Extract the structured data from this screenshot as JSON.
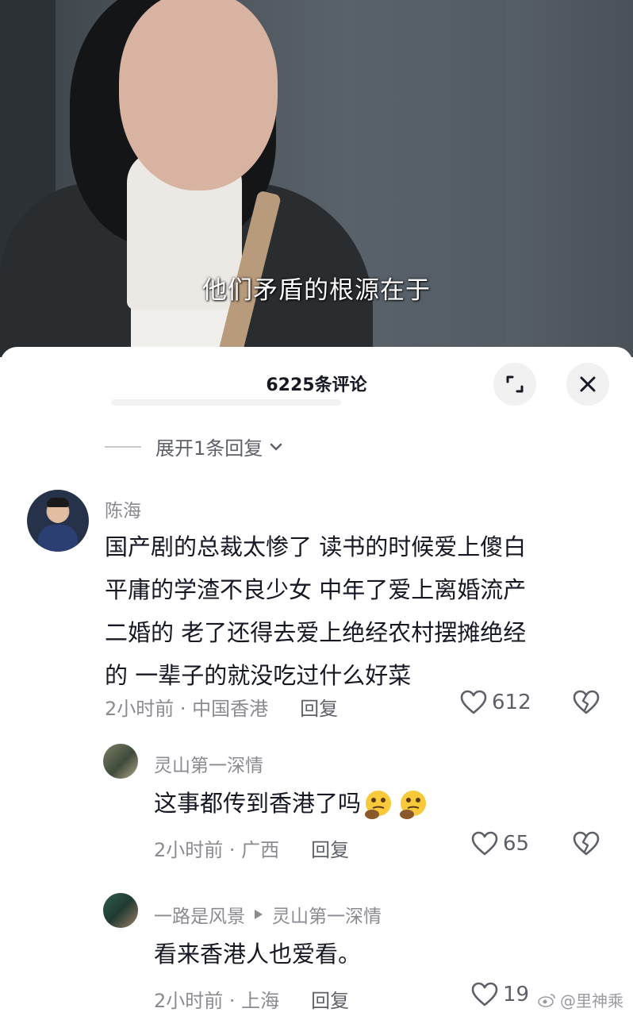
{
  "video": {
    "subtitle": "他们矛盾的根源在于"
  },
  "sheet": {
    "title": "6225条评论",
    "expand_icon": "expand-corners-icon",
    "close_icon": "close-icon",
    "expand_replies_label": "展开1条回复"
  },
  "comments": [
    {
      "username": "陈海",
      "text_lines": [
        "国产剧的总裁太惨了 读书的时候爱上傻白",
        "平庸的学渣不良少女 中年了爱上离婚流产",
        "二婚的  老了还得去爱上绝经农村摆摊绝经",
        "的   一辈子的就没吃过什么好菜"
      ],
      "time_location": "2小时前 · 中国香港",
      "reply_label": "回复",
      "likes": "612"
    },
    {
      "username": "灵山第一深情",
      "text": "这事都传到香港了吗",
      "time_location": "2小时前 · 广西",
      "reply_label": "回复",
      "likes": "65",
      "emoji": "thinking-face-icon"
    },
    {
      "username": "一路是风景",
      "reply_to": "灵山第一深情",
      "text": "看来香港人也爱看。",
      "time_location": "2小时前 · 上海",
      "reply_label": "回复",
      "likes": "19"
    }
  ],
  "watermark": "@里神乘",
  "colors": {
    "primary_text": "#161823",
    "secondary_text": "#8a8b91",
    "background": "#ffffff"
  }
}
